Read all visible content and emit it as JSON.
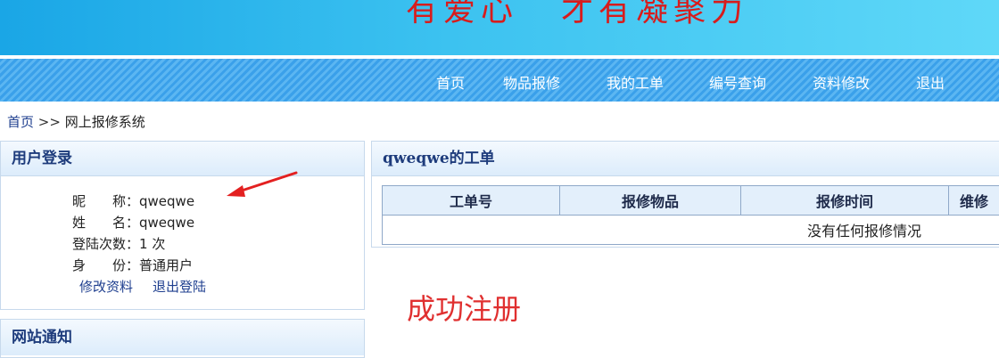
{
  "banner": {
    "slogan_part1": "有爱心",
    "slogan_part2": "才有凝聚力"
  },
  "nav": {
    "items": [
      {
        "label": "首页"
      },
      {
        "label": "物品报修"
      },
      {
        "label": "我的工单"
      },
      {
        "label": "编号查询"
      },
      {
        "label": "资料修改"
      },
      {
        "label": "退出"
      }
    ]
  },
  "breadcrumb": {
    "home": "首页",
    "separator": ">>",
    "current": "网上报修系统"
  },
  "login_panel": {
    "title": "用户登录",
    "nickname_label": "昵　　称：",
    "nickname_value": "qweqwe",
    "name_label": "姓　　名：",
    "name_value": "qweqwe",
    "login_count_label": "登陆次数：",
    "login_count_value": "1 次",
    "identity_label": "身　　份：",
    "identity_value": "普通用户",
    "edit_link": "修改资料",
    "logout_link": "退出登陆"
  },
  "notice_panel": {
    "title": "网站通知"
  },
  "orders_panel": {
    "title": "qweqwe的工单",
    "columns": [
      "工单号",
      "报修物品",
      "报修时间",
      "维修"
    ],
    "empty_message": "没有任何报修情况"
  },
  "success_message": "成功注册",
  "colors": {
    "accent_red": "#e03030",
    "nav_blue": "#3aa0ea",
    "link_blue": "#1f3f8f"
  }
}
